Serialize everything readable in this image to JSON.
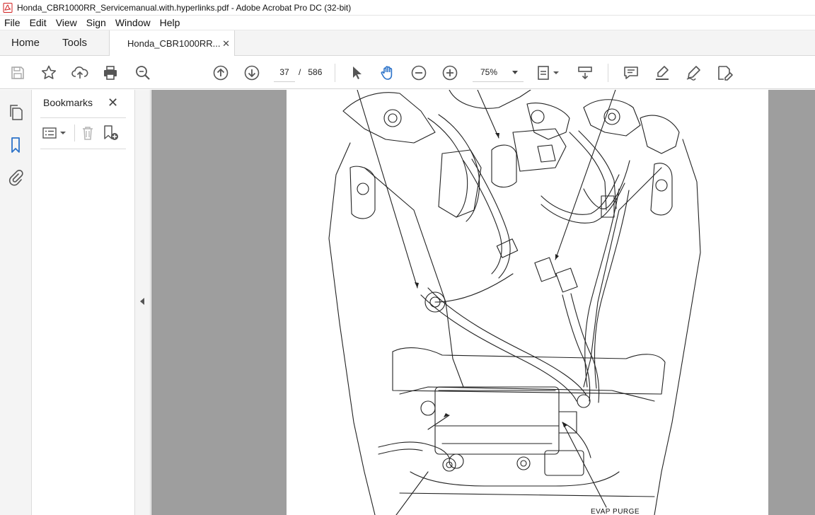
{
  "window": {
    "title": "Honda_CBR1000RR_Servicemanual.with.hyperlinks.pdf - Adobe Acrobat Pro DC (32-bit)",
    "icon": "acrobat-pdf-icon"
  },
  "menu": [
    "File",
    "Edit",
    "View",
    "Sign",
    "Window",
    "Help"
  ],
  "tabs": {
    "home": "Home",
    "tools": "Tools",
    "document": "Honda_CBR1000RR...",
    "close_glyph": "✕"
  },
  "toolbar": {
    "current_page": "37",
    "page_separator": "/",
    "total_pages": "586",
    "zoom": "75%",
    "icons": [
      "save-icon",
      "bookmark-star-icon",
      "upload-cloud-icon",
      "print-icon",
      "find-zoom-icon",
      "page-up-icon",
      "page-down-icon",
      "select-arrow-icon",
      "hand-icon",
      "zoom-out-icon",
      "zoom-in-icon",
      "fit-page-icon",
      "scroll-mode-icon",
      "comment-icon",
      "highlight-icon",
      "sign-icon",
      "fill-sign-icon"
    ]
  },
  "sidebar": {
    "icons": [
      "pages-icon",
      "bookmarks-icon",
      "attachments-icon"
    ]
  },
  "bookmarks": {
    "title": "Bookmarks",
    "close_glyph": "✕"
  },
  "document": {
    "caption": "EVAP PURGE"
  },
  "colors": {
    "accent_blue": "#2b72c9",
    "chrome_bg": "#f4f4f4",
    "doc_bg": "#9e9e9e",
    "icon_gray": "#555555"
  }
}
